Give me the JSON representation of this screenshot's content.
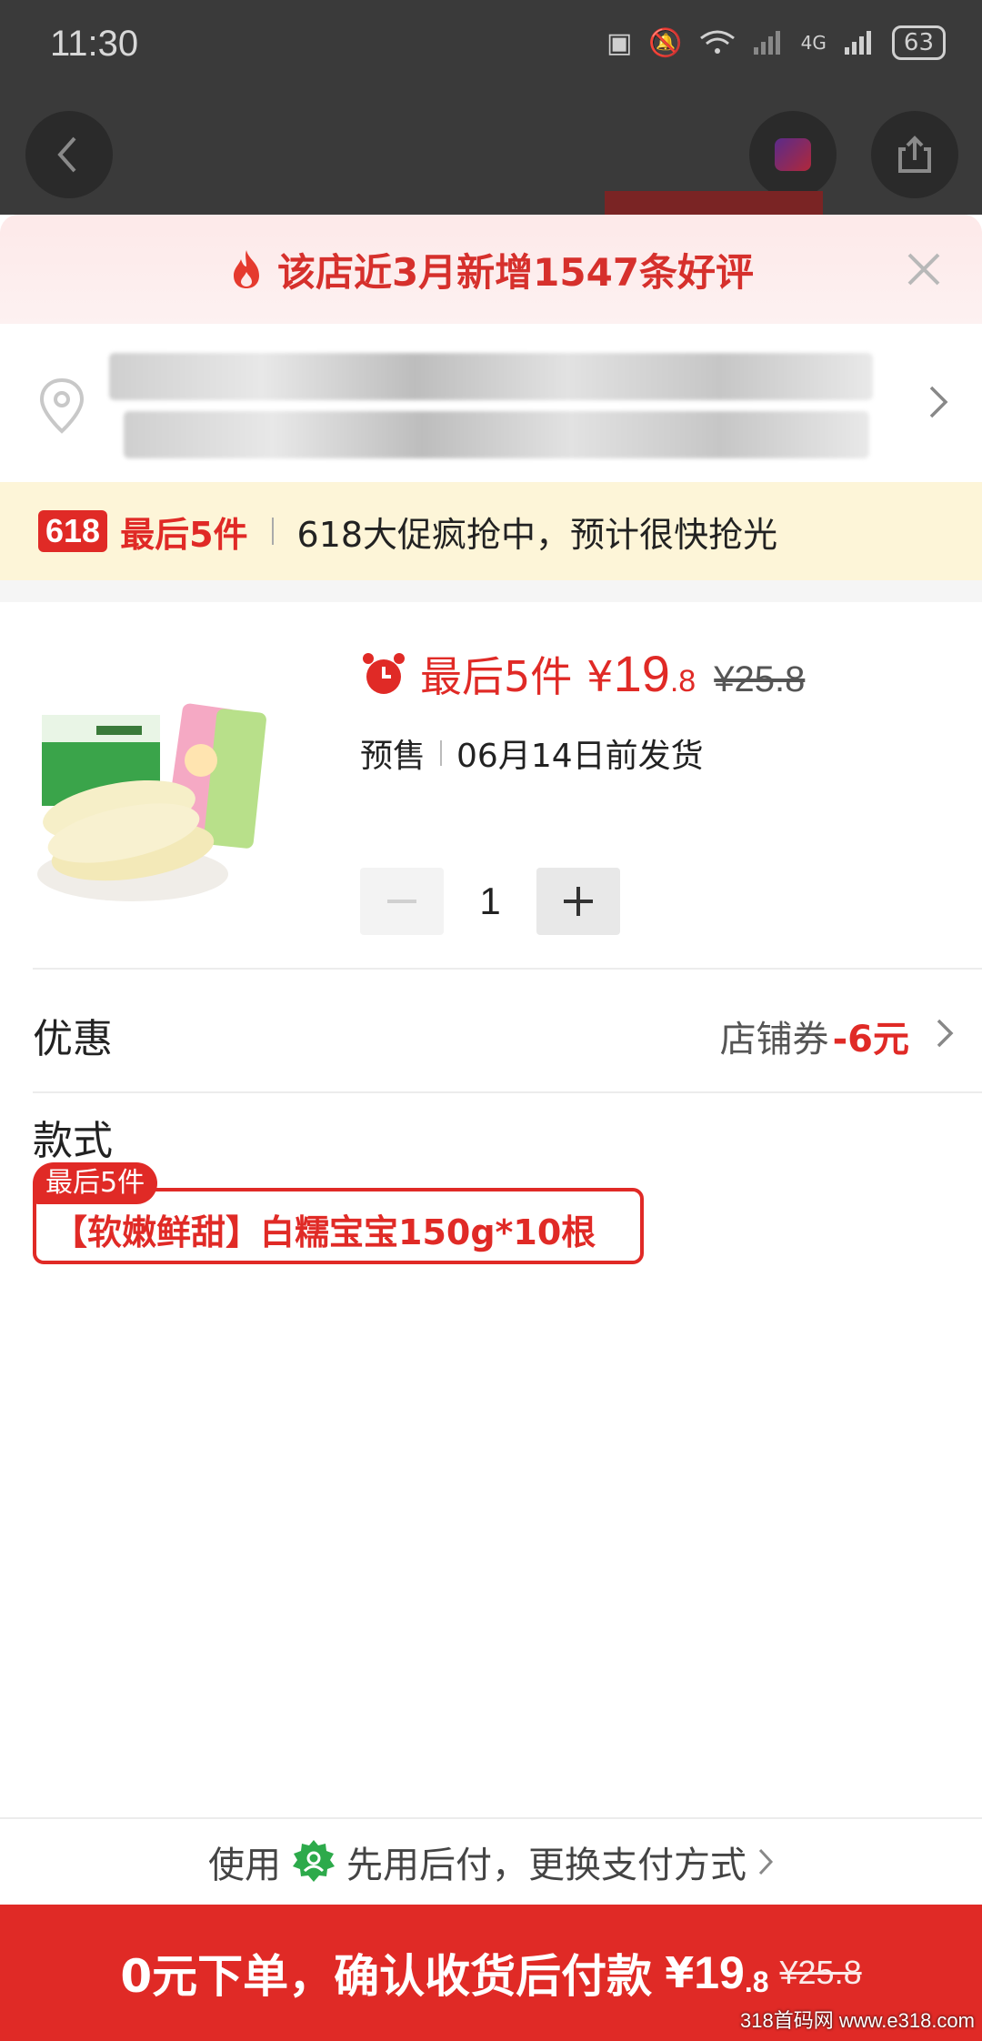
{
  "status_bar": {
    "time": "11:30",
    "network": "4G",
    "battery": "63"
  },
  "promo_banner": {
    "text": "该店近3月新增1547条好评"
  },
  "urgency": {
    "tag": "618",
    "stock": "最后5件",
    "message": "618大促疯抢中，预计很快抢光"
  },
  "product": {
    "stock_label": "最后5件",
    "currency": "¥",
    "price_int": "19",
    "price_dec": ".8",
    "original_price": "¥25.8",
    "shipping_type": "预售",
    "shipping_date": "06月14日前发货",
    "quantity": "1"
  },
  "discount": {
    "label": "优惠",
    "coupon_name": "店铺券",
    "coupon_amount": "-6元"
  },
  "style": {
    "label": "款式",
    "badge": "最后5件",
    "option": "【软嫩鲜甜】白糯宝宝150g*10根"
  },
  "paylater": {
    "prefix": "使用",
    "text": "先用后付，更换支付方式"
  },
  "submit": {
    "label": "0元下单，确认收货后付款",
    "currency": "¥",
    "price_int": "19",
    "price_dec": ".8",
    "original_price": "¥25.8"
  },
  "watermark": "318首码网 www.e318.com",
  "colors": {
    "accent": "#e02a26",
    "urgency_bg": "#fdf5d8",
    "banner_bg": "#fde9e9"
  }
}
